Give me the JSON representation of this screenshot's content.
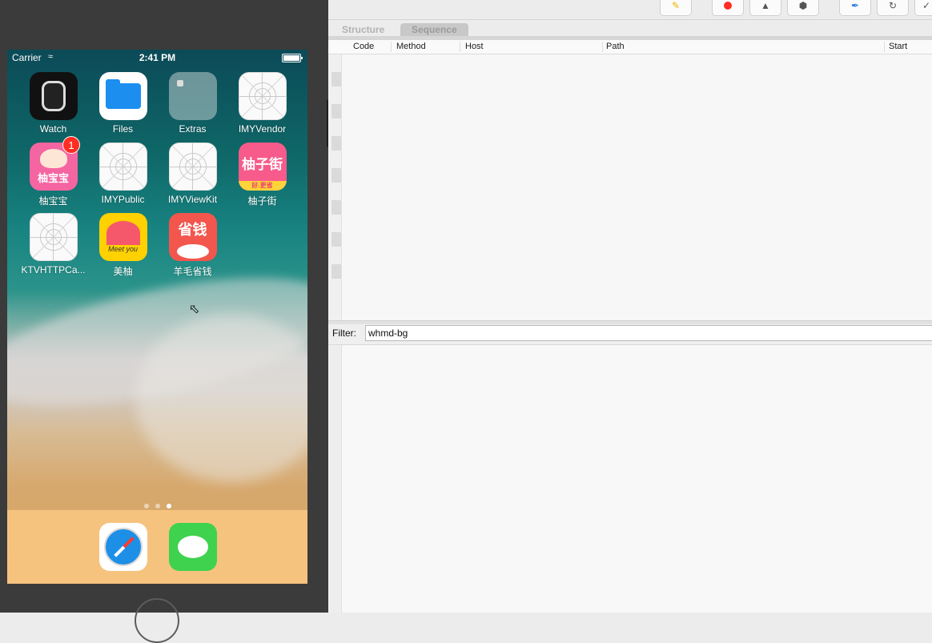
{
  "simulator": {
    "status_bar": {
      "carrier": "Carrier",
      "time": "2:41 PM"
    },
    "apps": [
      {
        "label": "Watch"
      },
      {
        "label": "Files"
      },
      {
        "label": "Extras"
      },
      {
        "label": "IMYVendor"
      },
      {
        "label": "柚宝宝",
        "badge": "1",
        "icon_text": "柚宝宝"
      },
      {
        "label": "IMYPublic"
      },
      {
        "label": "IMYViewKit"
      },
      {
        "label": "柚子街",
        "icon_text": "柚子街",
        "icon_subtext": "好.更省"
      },
      {
        "label": "KTVHTTPCa..."
      },
      {
        "label": "美柚",
        "icon_text": "Meet you"
      },
      {
        "label": "羊毛省钱",
        "icon_text": "省钱"
      }
    ],
    "page_indicator": {
      "pages": 3,
      "current": 3
    },
    "dock": [
      {
        "name": "Safari"
      },
      {
        "name": "Messages"
      }
    ]
  },
  "proxy_app": {
    "tabs": [
      {
        "label": "Structure",
        "active": false
      },
      {
        "label": "Sequence",
        "active": true
      }
    ],
    "columns": [
      "Code",
      "Method",
      "Host",
      "Path",
      "Start"
    ],
    "filter": {
      "label": "Filter:",
      "value": "whmd-bg"
    },
    "toolbar_icons": [
      "broom-icon",
      "record-icon",
      "throttle-turtle-icon",
      "breakpoint-hexagon-icon",
      "compose-pen-icon",
      "repeat-icon",
      "validate-check-icon"
    ],
    "colors": {
      "record": "#ff2d22",
      "compose": "#2f7be6"
    }
  }
}
